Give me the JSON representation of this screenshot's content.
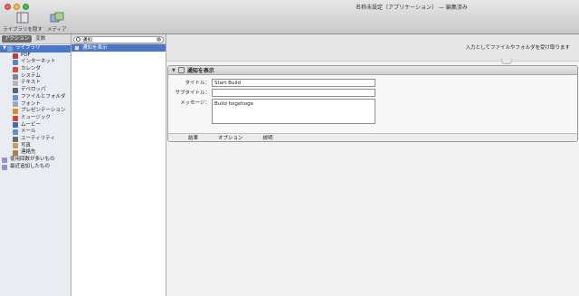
{
  "window": {
    "title": "名称未設定（アプリケーション） — 編集済み"
  },
  "toolbar": {
    "library_label": "ライブラリを隠す",
    "media_label": "メディア"
  },
  "left_panel": {
    "tabs": [
      {
        "label": "アクション",
        "active": true
      },
      {
        "label": "変数",
        "active": false
      }
    ],
    "items": [
      {
        "label": "ライブラリ",
        "level": 0,
        "selected": true,
        "color": "#7fa0d8",
        "icon": "library-icon"
      },
      {
        "label": "PDF",
        "level": 1,
        "color": "#c63b2f",
        "icon": "pdf-icon"
      },
      {
        "label": "インターネット",
        "level": 1,
        "color": "#4f86c6",
        "icon": "globe-icon"
      },
      {
        "label": "カレンダ",
        "level": 1,
        "color": "#d74b3b",
        "icon": "calendar-icon"
      },
      {
        "label": "システム",
        "level": 1,
        "color": "#7c8a98",
        "icon": "system-icon"
      },
      {
        "label": "テキスト",
        "level": 1,
        "color": "#b5b5b5",
        "icon": "text-icon"
      },
      {
        "label": "デベロッパ",
        "level": 1,
        "color": "#5a6270",
        "icon": "developer-icon"
      },
      {
        "label": "ファイルとフォルダ",
        "level": 1,
        "color": "#6a94d4",
        "icon": "folder-icon"
      },
      {
        "label": "フォント",
        "level": 1,
        "color": "#9aa8b8",
        "icon": "font-icon"
      },
      {
        "label": "プレゼンテーション",
        "level": 1,
        "color": "#e08a2e",
        "icon": "presentation-icon"
      },
      {
        "label": "ミュージック",
        "level": 1,
        "color": "#d9432e",
        "icon": "music-icon"
      },
      {
        "label": "ムービー",
        "level": 1,
        "color": "#3a6fb5",
        "icon": "movie-icon"
      },
      {
        "label": "メール",
        "level": 1,
        "color": "#5a8fd1",
        "icon": "mail-icon"
      },
      {
        "label": "ユーティリティ",
        "level": 1,
        "color": "#6a6a6a",
        "icon": "utility-icon"
      },
      {
        "label": "写真",
        "level": 1,
        "color": "#c0a060",
        "icon": "photo-icon"
      },
      {
        "label": "連絡先",
        "level": 1,
        "color": "#b07e4a",
        "icon": "contacts-icon"
      },
      {
        "label": "使用回数が多いもの",
        "level": 0,
        "color": "#9a8fc8",
        "icon": "most-used-icon"
      },
      {
        "label": "最近追加したもの",
        "level": 0,
        "color": "#9a8fc8",
        "icon": "recent-icon"
      }
    ]
  },
  "search": {
    "value": "通知"
  },
  "results": [
    {
      "label": "通知を表示",
      "selected": true
    }
  ],
  "workflow": {
    "drop_hint": "入力としてファイルやフォルダを受け取ります",
    "action": {
      "title": "通知を表示",
      "title_label": "タイトル：",
      "title_value": "Start Build",
      "subtitle_label": "サブタイトル：",
      "subtitle_value": "",
      "message_label": "メッセージ：",
      "message_value": "Build hogehoge",
      "footer": [
        "結果",
        "オプション",
        "説明"
      ]
    }
  }
}
